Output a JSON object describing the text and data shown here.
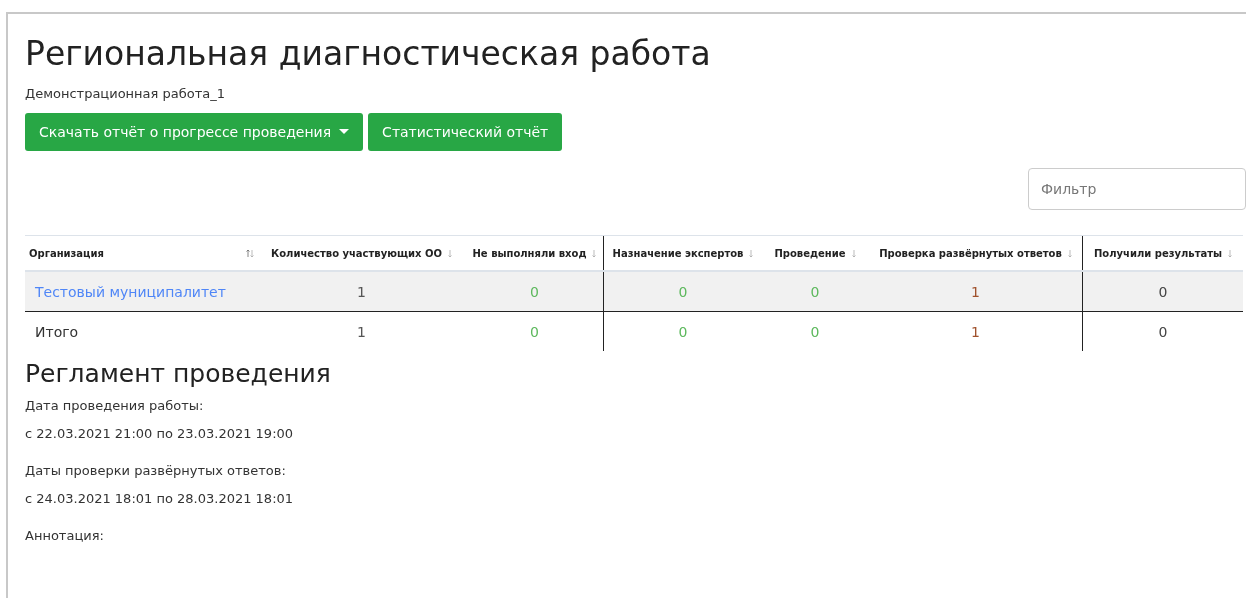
{
  "title": "Региональная диагностическая работа",
  "subtitle": "Демонстрационная работа_1",
  "buttons": [
    {
      "label": "Скачать отчёт о прогрессе проведения",
      "kind": "dropdown"
    },
    {
      "label": "Статистический отчёт",
      "kind": "plain"
    }
  ],
  "filter": {
    "placeholder": "Фильтр"
  },
  "table": {
    "columns": [
      {
        "label": "Организация",
        "color": "#333333",
        "divider": false
      },
      {
        "label": "Количество участвующих ОО",
        "color": "#555555",
        "divider": false
      },
      {
        "label": "Не выполняли вход",
        "color": "#5cb85c",
        "divider": true
      },
      {
        "label": "Назначение экспертов",
        "color": "#5cb85c",
        "divider": false
      },
      {
        "label": "Проведение",
        "color": "#5cb85c",
        "divider": false
      },
      {
        "label": "Проверка развёрнутых ответов",
        "color": "#a0522d",
        "divider": true
      },
      {
        "label": "Получили результаты",
        "color": "#444444",
        "divider": false
      }
    ],
    "rows": [
      {
        "kind": "link",
        "selected": true,
        "cells": [
          "Тестовый муниципалитет",
          "1",
          "0",
          "0",
          "0",
          "1",
          "0"
        ]
      },
      {
        "kind": "total",
        "selected": false,
        "cells": [
          "Итого",
          "1",
          "0",
          "0",
          "0",
          "1",
          "0"
        ]
      }
    ]
  },
  "schedule": {
    "heading": "Регламент проведения",
    "items": [
      {
        "label": "Дата проведения работы:",
        "value": "с 22.03.2021 21:00 по 23.03.2021 19:00"
      },
      {
        "label": "Даты проверки развёрнутых ответов:",
        "value": "с 24.03.2021 18:01 по 28.03.2021 18:01"
      },
      {
        "label": "Аннотация:"
      }
    ]
  }
}
